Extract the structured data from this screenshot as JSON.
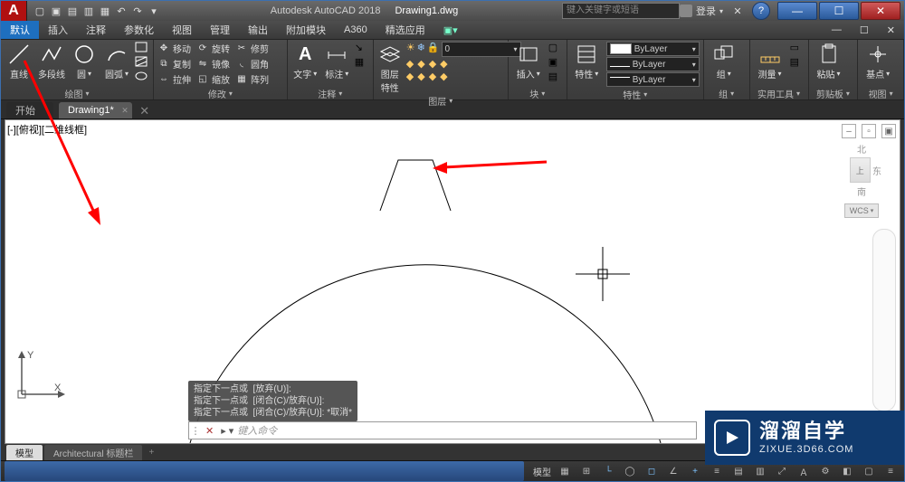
{
  "title": {
    "app": "Autodesk AutoCAD 2018",
    "doc": "Drawing1.dwg"
  },
  "search": {
    "placeholder": "键入关键字或短语"
  },
  "login": {
    "label": "登录"
  },
  "menu": {
    "items": [
      "默认",
      "插入",
      "注释",
      "参数化",
      "视图",
      "管理",
      "输出",
      "附加模块",
      "A360",
      "精选应用"
    ],
    "active": 0
  },
  "ribbon": {
    "draw": {
      "title": "绘图",
      "line": "直线",
      "polyline": "多段线",
      "circle": "圆",
      "arc": "圆弧"
    },
    "modify": {
      "title": "修改",
      "move": "移动",
      "rotate": "旋转",
      "trim": "修剪",
      "copy": "复制",
      "mirror": "镜像",
      "fillet": "圆角",
      "stretch": "拉伸",
      "scale": "缩放",
      "array": "阵列"
    },
    "annot": {
      "title": "注释",
      "text": "文字",
      "dim": "标注"
    },
    "layers": {
      "title": "图层",
      "props": "图层\n特性",
      "current": "0"
    },
    "block": {
      "title": "块",
      "insert": "插入"
    },
    "props": {
      "title": "特性",
      "btn": "特性",
      "bylayer": "ByLayer"
    },
    "group": {
      "title": "组",
      "btn": "组"
    },
    "util": {
      "title": "实用工具",
      "measure": "测量"
    },
    "clip": {
      "title": "剪贴板",
      "paste": "粘贴"
    },
    "view": {
      "title": "视图",
      "base": "基点"
    }
  },
  "doctabs": {
    "start": "开始",
    "drawing": "Drawing1*"
  },
  "viewport": {
    "label": "[-][俯视][二维线框]",
    "cube": {
      "n": "北",
      "top": "上",
      "e": "东",
      "s": "南",
      "wcs": "WCS"
    }
  },
  "cmd": {
    "history": "指定下一点或  [放弃(U)]:\n指定下一点或  [闭合(C)/放弃(U)]:\n指定下一点或  [闭合(C)/放弃(U)]: *取消*",
    "prompt": "键入命令"
  },
  "layout": {
    "model": "模型",
    "arch": "Architectural 标题栏"
  },
  "status": {
    "model": "模型"
  },
  "watermark": {
    "cn": "溜溜自学",
    "url": "ZIXUE.3D66.COM"
  }
}
